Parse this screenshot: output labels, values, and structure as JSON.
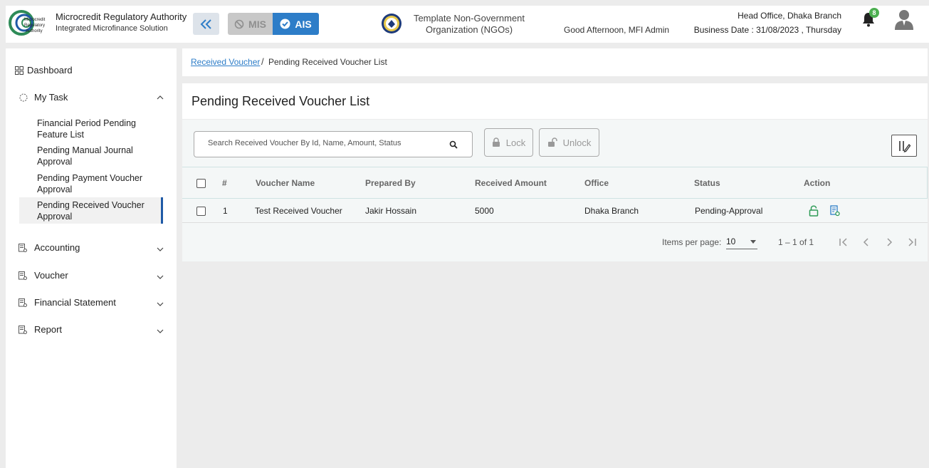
{
  "header": {
    "brand_title": "Microcredit Regulatory Authority",
    "brand_subtitle": "Integrated Microfinance Solution",
    "logo_text": [
      "Microcredit",
      "Regulatory",
      "Authority"
    ],
    "mode_mis": "MIS",
    "mode_ais": "AIS",
    "org_line1": "Template Non-Government",
    "org_line2": "Organization (NGOs)",
    "greeting": "Good Afternoon, MFI Admin",
    "branch": "Head Office, Dhaka Branch",
    "business_date": "Business Date : 31/08/2023 , Thursday",
    "notification_count": "8"
  },
  "sidebar": {
    "dashboard": "Dashboard",
    "my_task": "My Task",
    "my_task_items": [
      "Financial Period Pending Feature List",
      "Pending Manual Journal Approval",
      "Pending Payment Voucher Approval",
      "Pending Received Voucher Approval"
    ],
    "accounting": "Accounting",
    "voucher": "Voucher",
    "financial_statement": "Financial Statement",
    "report": "Report"
  },
  "breadcrumb": {
    "parent": "Received Voucher",
    "separator": "/",
    "current": "Pending Received Voucher List"
  },
  "page_title": "Pending Received Voucher List",
  "toolbar": {
    "search_placeholder": "Search Received Voucher By Id, Name, Amount, Status",
    "lock_label": "Lock",
    "unlock_label": "Unlock"
  },
  "table": {
    "headers": [
      "#",
      "Voucher Name",
      "Prepared By",
      "Received Amount",
      "Office",
      "Status",
      "Action"
    ],
    "rows": [
      {
        "no": "1",
        "voucher_name": "Test Received Voucher",
        "prepared_by": "Jakir Hossain",
        "amount": "5000",
        "office": "Dhaka Branch",
        "status": "Pending-Approval"
      }
    ]
  },
  "pagination": {
    "items_per_page_label": "Items per page:",
    "items_per_page": "10",
    "range": "1 – 1 of 1"
  },
  "colors": {
    "accent": "#2d7dc8",
    "active_bar": "#1f5aa6",
    "badge": "#4caf50",
    "action_icon": "#2e9b57"
  }
}
